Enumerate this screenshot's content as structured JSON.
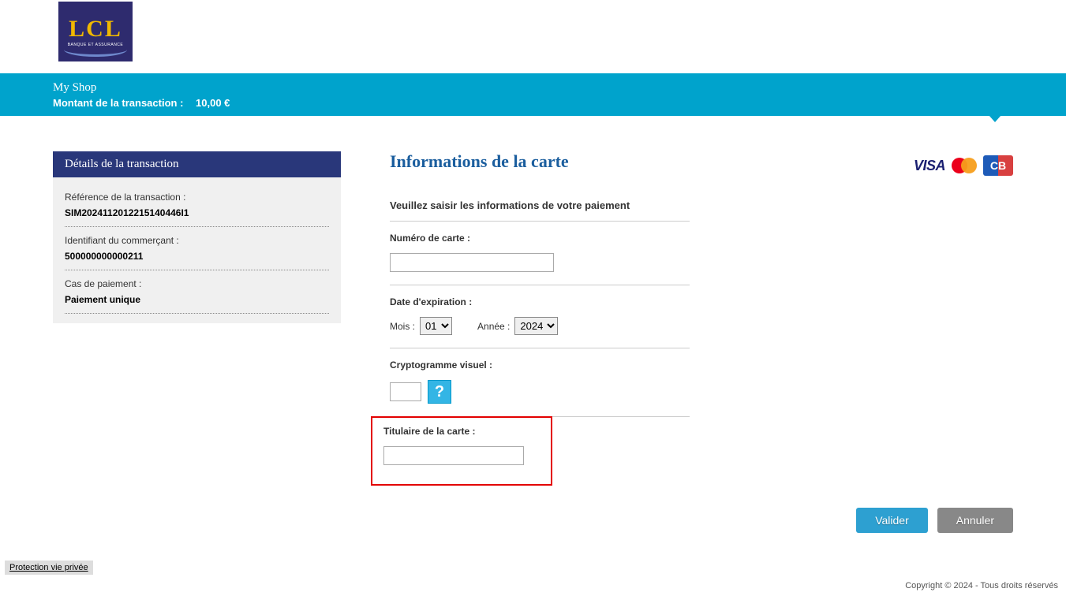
{
  "logo": {
    "main": "LCL",
    "sub": "BANQUE ET ASSURANCE"
  },
  "header": {
    "shop_name": "My Shop",
    "amount_label": "Montant de la transaction  :",
    "amount_value": "10,00 €"
  },
  "sidebar": {
    "title": "Détails de la transaction",
    "ref_label": "Référence de la transaction :",
    "ref_value": "SIM2024112012215140446I1",
    "merchant_label": "Identifiant du commerçant :",
    "merchant_value": "500000000000211",
    "case_label": "Cas de paiement :",
    "case_value": "Paiement unique"
  },
  "form": {
    "title": "Informations de la carte",
    "instruction": "Veuillez saisir les informations de votre paiement",
    "card_number_label": "Numéro de carte :",
    "expiry_label": "Date d'expiration :",
    "month_label": "Mois :",
    "month_value": "01",
    "year_label": "Année :",
    "year_value": "2024",
    "cvv_label": "Cryptogramme visuel :",
    "help_symbol": "?",
    "holder_label": "Titulaire de la carte :"
  },
  "card_brands": {
    "visa": "VISA",
    "cb": "CB"
  },
  "buttons": {
    "validate": "Valider",
    "cancel": "Annuler"
  },
  "footer": {
    "privacy": "Protection vie privée",
    "copyright": "Copyright © 2024 - Tous droits réservés"
  }
}
